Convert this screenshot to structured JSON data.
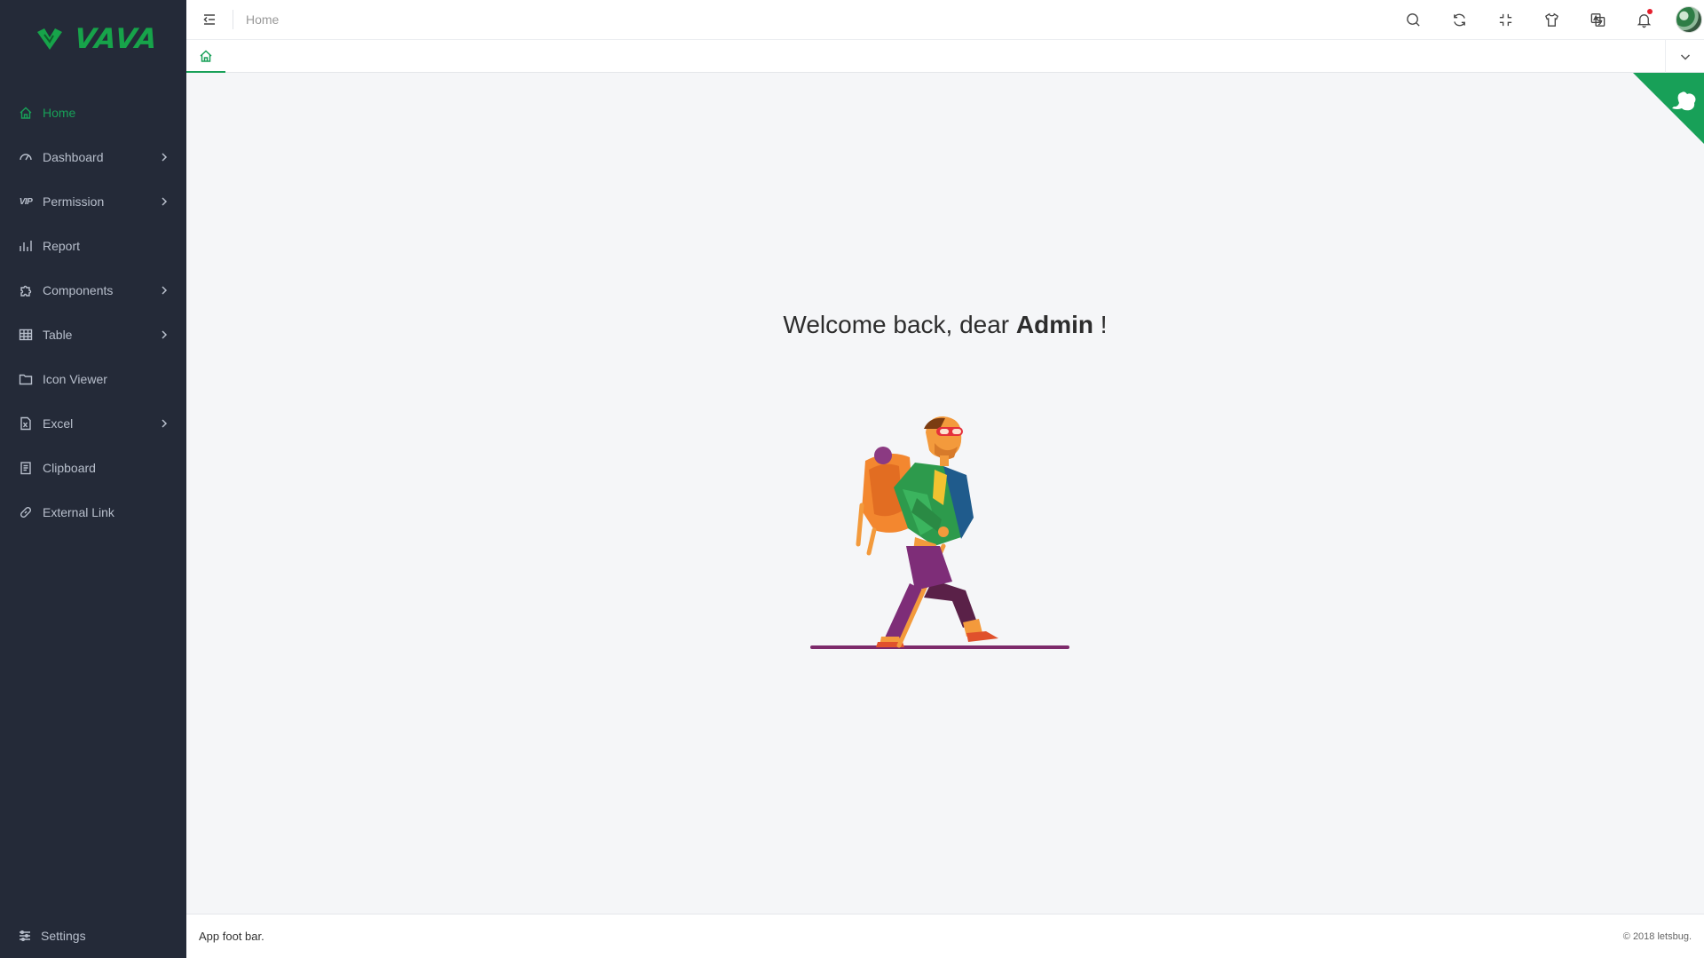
{
  "app": {
    "logo_text": "VAVA",
    "brand_color": "#18a058"
  },
  "sidebar": {
    "items": [
      {
        "label": "Home",
        "icon": "home-icon",
        "active": true,
        "has_children": false
      },
      {
        "label": "Dashboard",
        "icon": "gauge-icon",
        "has_children": true
      },
      {
        "label": "Permission",
        "icon": "vip-icon",
        "has_children": true
      },
      {
        "label": "Report",
        "icon": "bar-chart-icon",
        "has_children": false
      },
      {
        "label": "Components",
        "icon": "puzzle-icon",
        "has_children": true
      },
      {
        "label": "Table",
        "icon": "table-icon",
        "has_children": true
      },
      {
        "label": "Icon Viewer",
        "icon": "folder-icon",
        "has_children": false
      },
      {
        "label": "Excel",
        "icon": "excel-icon",
        "has_children": true
      },
      {
        "label": "Clipboard",
        "icon": "clipboard-icon",
        "has_children": false
      },
      {
        "label": "External Link",
        "icon": "link-icon",
        "has_children": false
      }
    ],
    "settings_label": "Settings",
    "vip_text": "VIP"
  },
  "header": {
    "breadcrumb": "Home",
    "actions": [
      "search-icon",
      "refresh-icon",
      "fullscreen-exit-icon",
      "theme-shirt-icon",
      "translate-icon",
      "bell-icon"
    ]
  },
  "main": {
    "welcome_prefix": "Welcome back, dear ",
    "welcome_name": "Admin",
    "welcome_suffix": " !"
  },
  "footer": {
    "left": "App foot bar.",
    "right": "© 2018 letsbug."
  }
}
